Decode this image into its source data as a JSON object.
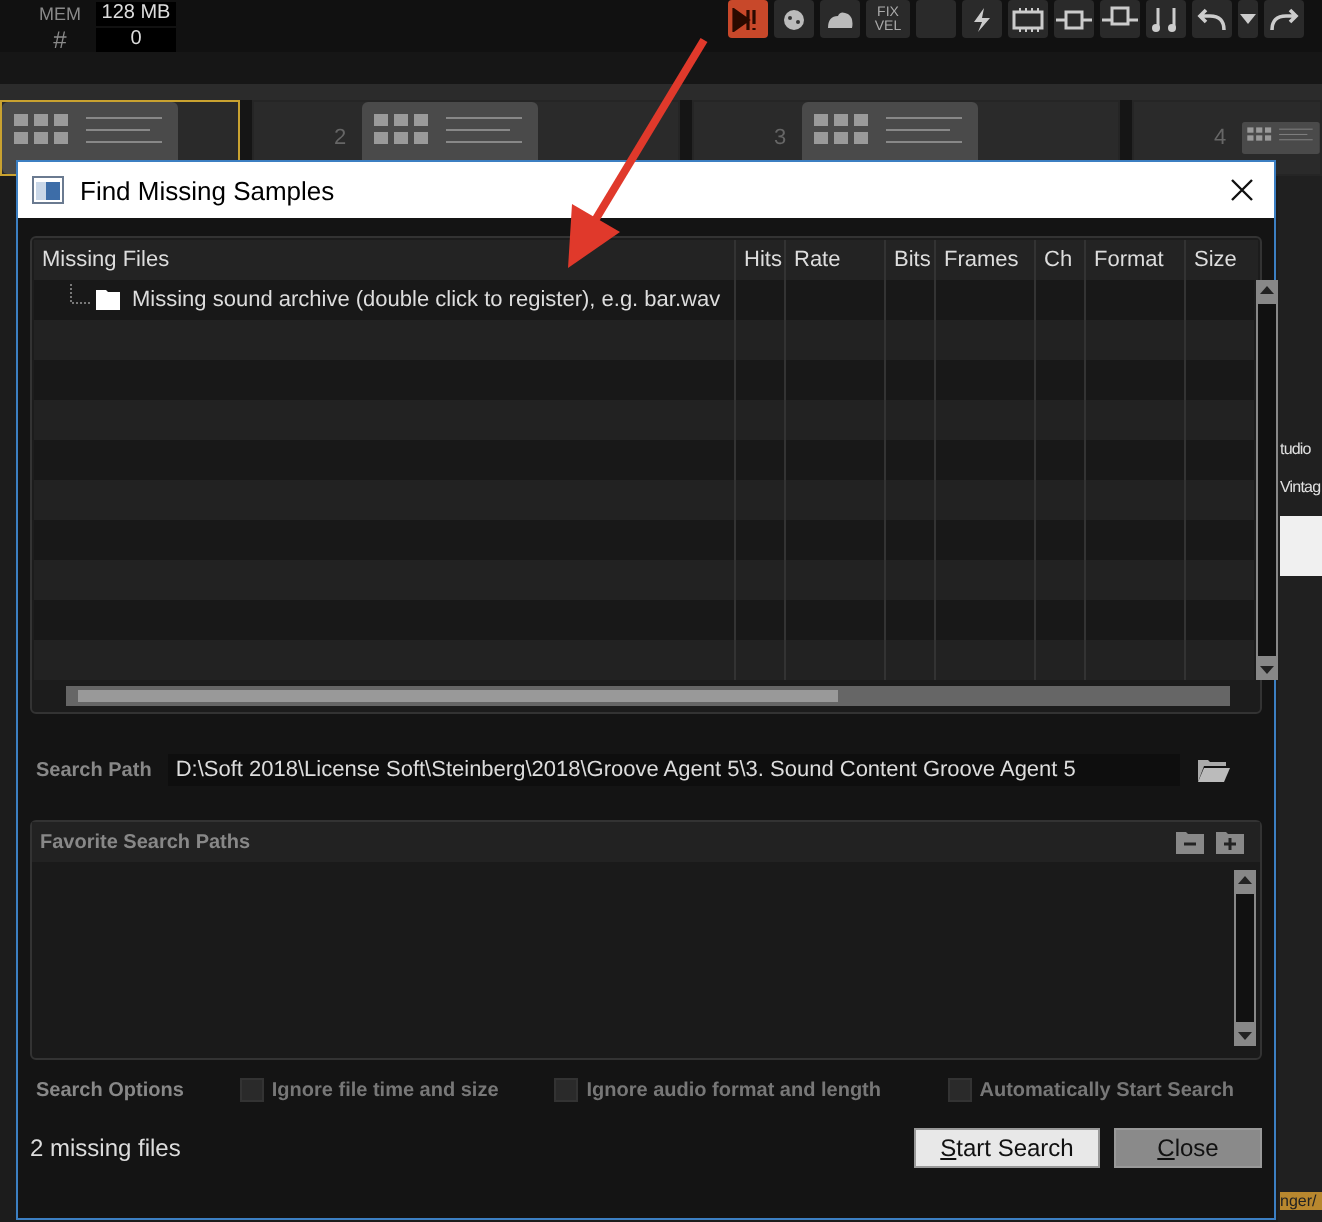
{
  "host": {
    "mem_label": "MEM",
    "mem_value": "128 MB",
    "count_label": "#",
    "count_value": "0",
    "toolbar": [
      {
        "kind": "alert",
        "active": true
      },
      {
        "kind": "dice"
      },
      {
        "kind": "cloud"
      },
      {
        "kind": "text",
        "label": "FIX VEL"
      },
      {
        "kind": "blank"
      },
      {
        "kind": "bolt"
      },
      {
        "kind": "chip"
      },
      {
        "kind": "plug"
      },
      {
        "kind": "plug2"
      },
      {
        "kind": "note"
      },
      {
        "kind": "undo"
      },
      {
        "kind": "caret"
      },
      {
        "kind": "redo"
      }
    ],
    "pads": [
      {
        "selected": true
      },
      {
        "selected": false,
        "number": "2"
      },
      {
        "selected": false,
        "number": "3"
      },
      {
        "selected": false,
        "number": "4"
      }
    ],
    "side_labels": [
      "tudio",
      "Vintag"
    ],
    "bottom_label": "nger/"
  },
  "dialog": {
    "title": "Find Missing Samples",
    "columns": [
      "Missing Files",
      "Hits",
      "Rate",
      "Bits",
      "Frames",
      "Ch",
      "Format",
      "Size"
    ],
    "rows": [
      {
        "kind": "folder",
        "name": "Missing sound archive (double click to register), e.g. bar.wav"
      }
    ],
    "search_path": {
      "label": "Search Path",
      "value": "D:\\Soft 2018\\License Soft\\Steinberg\\2018\\Groove Agent 5\\3. Sound Content Groove Agent 5"
    },
    "favorites_title": "Favorite Search Paths",
    "options_label": "Search Options",
    "options": [
      {
        "label": "Ignore file time and size",
        "checked": false
      },
      {
        "label": "Ignore audio format and length",
        "checked": false
      },
      {
        "label": "Automatically Start Search",
        "checked": false
      }
    ],
    "status": "2 missing files",
    "buttons": [
      {
        "accesskey": "S",
        "label_rest": "tart Search",
        "kind": "primary"
      },
      {
        "accesskey": "C",
        "label_rest": "lose",
        "kind": "secondary"
      }
    ]
  }
}
